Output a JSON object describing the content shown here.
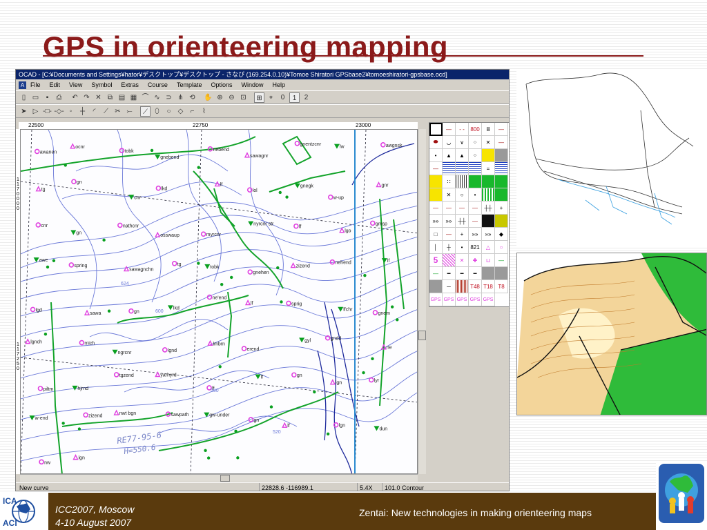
{
  "slide": {
    "title": "GPS in orienteering mapping"
  },
  "ocad": {
    "window_title": "OCAD  - [C:¥Documents and Settings¥hator¥デスクトップ¥デスクトップ - さなぴ (169.254.0.10)¥Tomoe Shiratori GPSbase2¥tomoeshiratori-gpsbase.ocd]",
    "menu": [
      "File",
      "Edit",
      "View",
      "Symbol",
      "Extras",
      "Course",
      "Template",
      "Options",
      "Window",
      "Help"
    ],
    "toolbar_numbers": [
      "0",
      "1",
      "2"
    ],
    "ruler_top": [
      "22500",
      "22750",
      "23000"
    ],
    "ruler_left_top": [
      "1",
      "1",
      "7",
      "0",
      "0",
      "0",
      "0"
    ],
    "ruler_left_bottom": [
      "1",
      "1",
      "7",
      "2",
      "5",
      "0"
    ],
    "map_labels": [
      "awanen",
      "ocnr",
      "tobk",
      "gnebend",
      "nebend",
      "sawagnr",
      "gnentzcnr",
      "lw",
      "awgnsk",
      "tg",
      "gn",
      "cnr",
      "lkd",
      "lf",
      "lol",
      "gnegk",
      "w-up",
      "gnr",
      "cnr",
      "gn",
      "nathcnr",
      "osswaup",
      "myrcnr",
      "nyrcnr str",
      "lf",
      "lgo",
      "gmsp",
      "awe",
      "spring",
      "sawagnchn",
      "tg",
      "tobk",
      "gnehen",
      "zizend",
      "nehend",
      "lf",
      "lgd",
      "sawa",
      "gn",
      "lkd",
      "ne'end",
      "lf",
      "sprig",
      "lfchr",
      "gnem",
      "lgnch",
      "mich",
      "ngrcnr",
      "lgnd",
      "lmbrn",
      "erend",
      "gyl",
      "gndd",
      "ne",
      "piltm",
      "hjrnd",
      "tgzend",
      "yarhyrd",
      "lf",
      "lf",
      "gn",
      "lgn",
      "lyr",
      "w-end",
      "zizend",
      "nwt bgn",
      "sawpath",
      "gw-under",
      "gn",
      "lf",
      "lgn",
      "dun",
      "nw",
      "lgn"
    ],
    "map_watermark_1": "RE77-95-6",
    "map_watermark_2": "H=550.6",
    "contour_labels": [
      "624",
      "600",
      "550",
      "520"
    ],
    "symbol_labels": [
      "800",
      "821",
      "5",
      "T48",
      "T18",
      "T8",
      "GPS",
      "GPS",
      "GPS",
      "GPS",
      "GPS"
    ],
    "status": {
      "mode": "New curve",
      "coords": "22828.6   -116989.1",
      "zoom": "5.4X",
      "symbol": "101.0 Contour"
    }
  },
  "footer": {
    "ica_line1": "ICA",
    "ica_line2": "ACI",
    "conference": "ICC2007, Moscow",
    "dates": "4-10 August 2007",
    "talk": "Zentai: New technologies in making orienteering maps"
  },
  "colors": {
    "title": "#8b1a1a",
    "footer_bg": "#5a3a0d",
    "magenta_point": "#e040e0",
    "green_symbol": "#0aa020",
    "contour_blue": "#6070d0"
  }
}
